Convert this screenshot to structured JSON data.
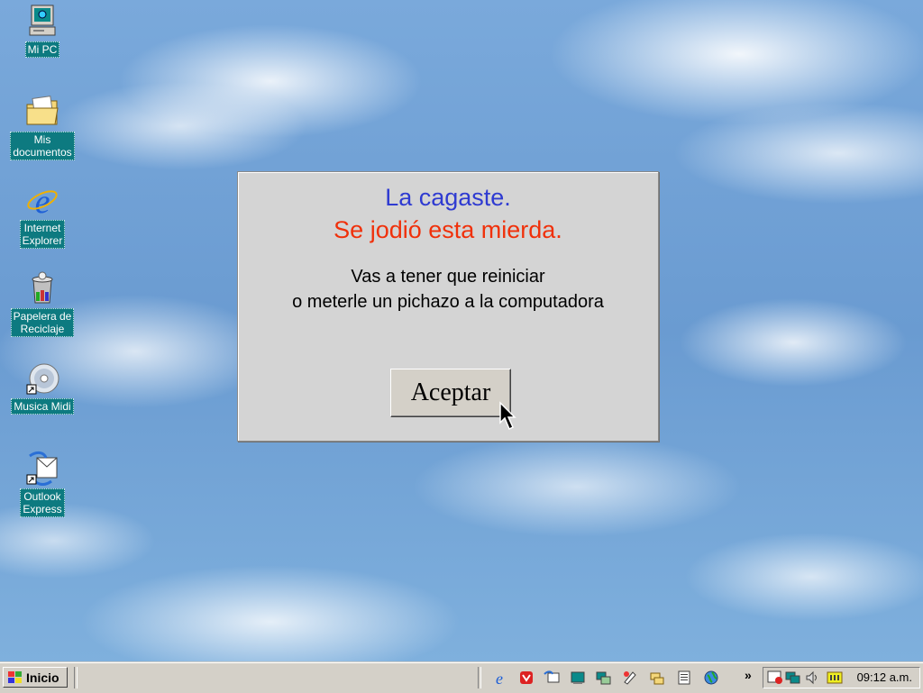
{
  "desktop": {
    "icons": [
      {
        "label": "Mi PC"
      },
      {
        "label1": "Mis",
        "label2": "documentos"
      },
      {
        "label1": "Internet",
        "label2": "Explorer"
      },
      {
        "label1": "Papelera de",
        "label2": "Reciclaje"
      },
      {
        "label": "Musica Midi"
      },
      {
        "label1": "Outlook",
        "label2": "Express"
      }
    ]
  },
  "dialog": {
    "line1": "La cagaste.",
    "line2": "Se jodió esta mierda.",
    "message1": "Vas a tener que reiniciar",
    "message2": "o meterle un pichazo a la computadora",
    "button_label": "Aceptar"
  },
  "taskbar": {
    "start_label": "Inicio",
    "chevron": "»",
    "clock": "09:12 a.m."
  },
  "colors": {
    "title_blue": "#2f3bd1",
    "title_red": "#f0300a",
    "icon_label_bg": "#0d7a80"
  }
}
